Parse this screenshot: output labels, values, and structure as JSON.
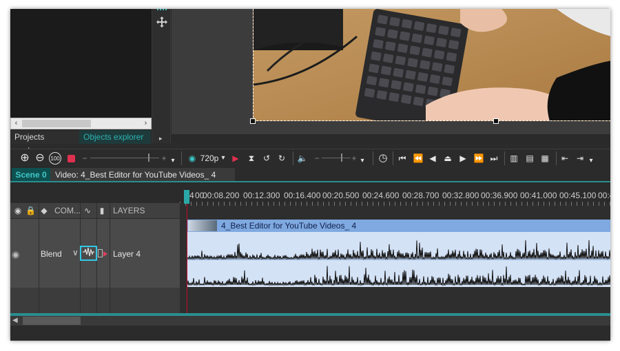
{
  "panels": {
    "tabs": [
      {
        "label": "Projects explorer",
        "active": false
      },
      {
        "label": "Objects explorer",
        "active": true
      }
    ],
    "scroll_left": "‹",
    "scroll_right": "›"
  },
  "tools": {
    "move_icon": "move-icon",
    "more_arrow": "▸"
  },
  "toolbar": {
    "zoom_in": "⊕",
    "zoom_out": "⊖",
    "zoom_100": "100",
    "quality_label": "720p",
    "quality_caret": "▾",
    "play_preview": "▶",
    "minus": "−",
    "plus": "+",
    "more": "▾"
  },
  "scene": {
    "scene_tab": "Scene 0",
    "video_tab": "Video: 4_Best Editor for YouTube Videos_ 4"
  },
  "layers_header": {
    "com_label": "COM...",
    "layers_label": "LAYERS"
  },
  "layer": {
    "blend_label": "Blend",
    "chevron": "∨",
    "name": "Layer 4"
  },
  "ruler": {
    "start_label": "4",
    "tick_suffix": "00",
    "ticks": [
      "00:08.200",
      "00:12.300",
      "00:16.400",
      "00:20.500",
      "00:24.600",
      "00:28.700",
      "00:32.800",
      "00:36.900",
      "00:41.000",
      "00:45.100",
      "00:4"
    ]
  },
  "clip": {
    "title": "4_Best Editor for YouTube Videos_ 4"
  },
  "colors": {
    "accent": "#2bb3b3",
    "playhead": "#c0102a",
    "clip_header": "#7fa9e0",
    "waveform_bg": "#d4e2f6"
  }
}
